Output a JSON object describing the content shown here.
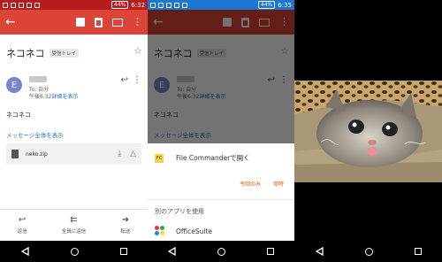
{
  "status_left": {
    "time": "6:32",
    "battery": "44%"
  },
  "status_mid": {
    "time": "6:35",
    "battery": "44%"
  },
  "email": {
    "subject": "ネコネコ",
    "folder_label": "受信トレイ",
    "avatar_letter": "E",
    "to": "To: 自分",
    "time": "午後6:32",
    "details_link": "詳細を表示",
    "body": "ネコネコ",
    "show_full_message": "メッセージ全体を表示",
    "attachment_name": "neko.zip"
  },
  "bottom_actions": [
    {
      "icon": "reply-icon",
      "label": "返信"
    },
    {
      "icon": "reply-all-icon",
      "label": "全員に返信"
    },
    {
      "icon": "forward-icon",
      "label": "転送"
    }
  ],
  "open_with_sheet": {
    "app_icon_text": "FC",
    "open_with_title": "File Commanderで開く",
    "just_once": "今回のみ",
    "always": "常時",
    "use_other_app": "別のアプリを使用",
    "office_suite": "OfficeSuite"
  },
  "colors": {
    "gmail_red": "#db4437",
    "status_red": "#b71c1c",
    "status_blue": "#1976d2",
    "link_blue": "#1e70c1",
    "sheet_action_orange": "#e65100"
  }
}
